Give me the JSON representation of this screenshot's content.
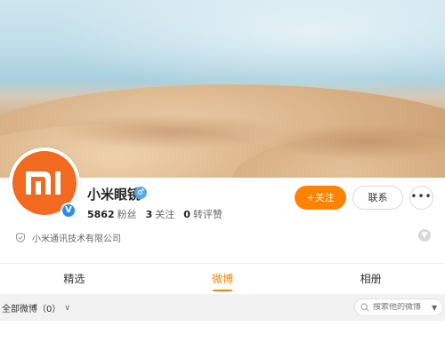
{
  "profile": {
    "name": "小米眼镜",
    "gender_icon": "male-icon",
    "verified_icon": "verified-v-icon",
    "company": "小米通讯技术有限公司",
    "stats": [
      {
        "number": "5862",
        "label": "粉丝"
      },
      {
        "number": "3",
        "label": "关注"
      },
      {
        "number": "0",
        "label": "转评赞"
      }
    ]
  },
  "actions": {
    "follow_label": "+关注",
    "contact_label": "联系",
    "more_label": "•••"
  },
  "tabs": [
    {
      "label": "精选",
      "active": false
    },
    {
      "label": "微博",
      "active": true
    },
    {
      "label": "相册",
      "active": false
    }
  ],
  "filter": {
    "label": "全部微博（0）",
    "search_placeholder": "搜索他的微博"
  },
  "colors": {
    "accent": "#ff8200",
    "brand": "#f16a1f",
    "verified": "#2d8cf0"
  }
}
